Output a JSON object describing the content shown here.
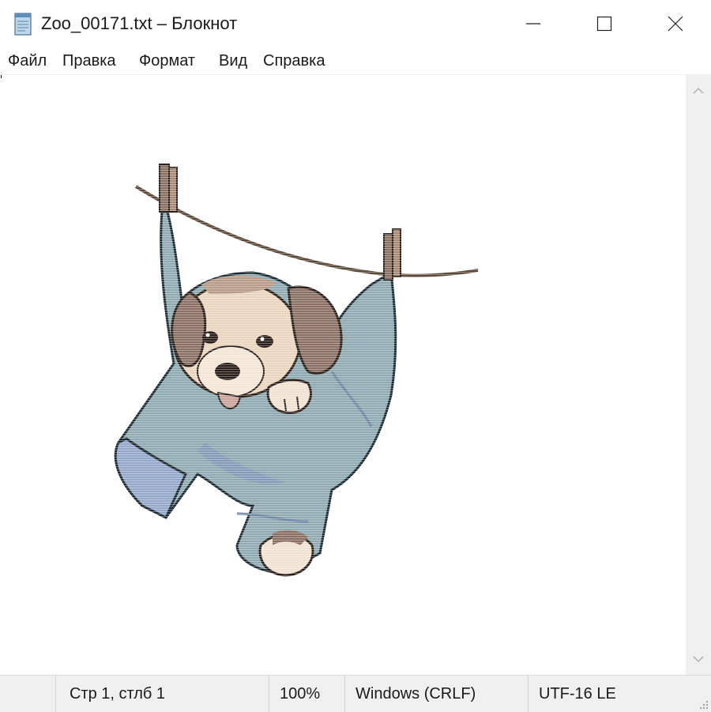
{
  "window": {
    "title": "Zoo_00171.txt – Блокнот",
    "icon": "notepad-icon"
  },
  "caption_buttons": {
    "minimize_icon": "minimize-icon",
    "maximize_icon": "maximize-icon",
    "close_icon": "close-icon"
  },
  "menu": {
    "items": [
      {
        "label": "Файл"
      },
      {
        "label": "Правка"
      },
      {
        "label": "Формат"
      },
      {
        "label": "Вид"
      },
      {
        "label": "Справка"
      }
    ]
  },
  "editor": {
    "content_description_icon": "ascii-art-puppy-in-hanging-pants"
  },
  "statusbar": {
    "position": "Стр 1, стлб 1",
    "zoom": "100%",
    "line_endings": "Windows (CRLF)",
    "encoding": "UTF-16 LE"
  },
  "colors": {
    "pants": "#8fa9b0",
    "pants_shadow": "#7f95b8",
    "fur_light": "#e9d5bd",
    "fur_dark": "#8a7064",
    "rope": "#5a4a3a"
  }
}
